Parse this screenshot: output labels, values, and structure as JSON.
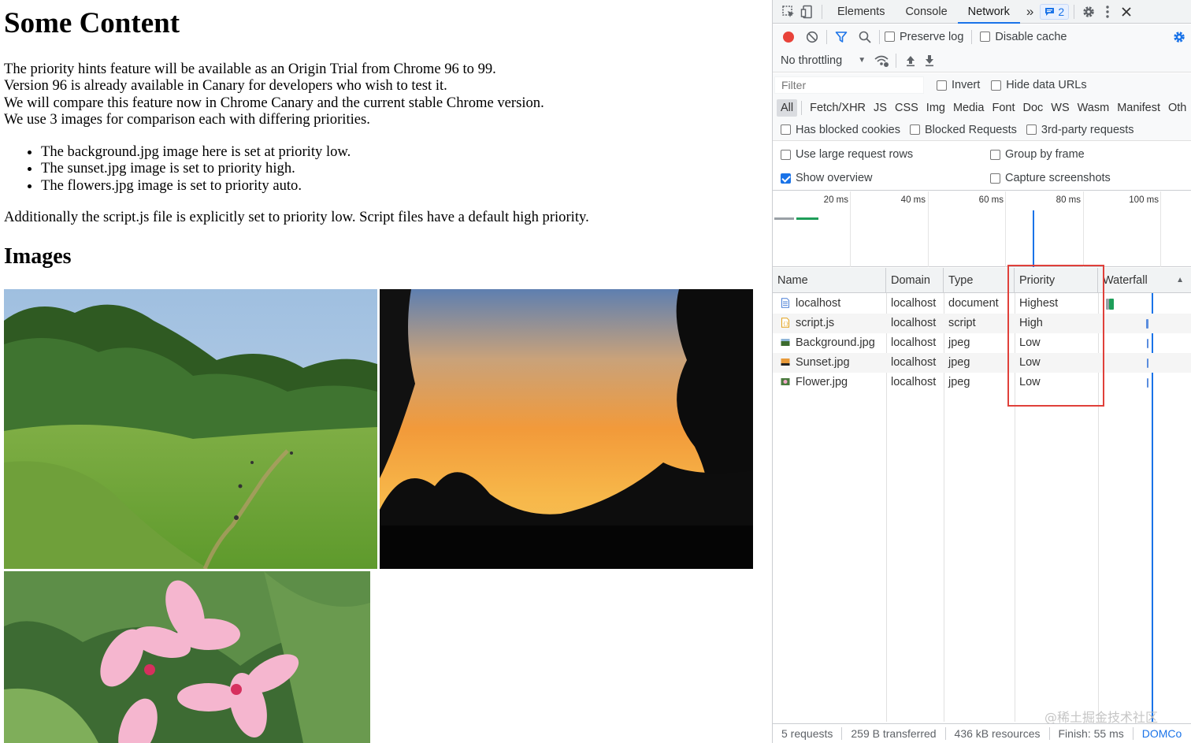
{
  "page": {
    "heading": "Some Content",
    "paragraph_lines": [
      "The priority hints feature will be available as an Origin Trial from Chrome 96 to 99.",
      "Version 96 is already available in Canary for developers who wish to test it.",
      "We will compare this feature now in Chrome Canary and the current stable Chrome version.",
      "We use 3 images for comparison each with differing priorities."
    ],
    "bullets": [
      "The background.jpg image here is set at priority low.",
      "The sunset.jpg image is set to priority high.",
      "The flowers.jpg image is set to priority auto."
    ],
    "paragraph2": "Additionally the script.js file is explicitly set to priority low. Script files have a default high priority.",
    "images_heading": "Images"
  },
  "devtools": {
    "tabs": [
      "Elements",
      "Console",
      "Network"
    ],
    "active_tab": "Network",
    "more_tabs": "»",
    "issues_count": "2",
    "toolbar": {
      "preserve_log": "Preserve log",
      "disable_cache": "Disable cache",
      "throttling": "No throttling",
      "throttling_caret": "▼"
    },
    "filter": {
      "placeholder": "Filter",
      "invert": "Invert",
      "hide_data_urls": "Hide data URLs"
    },
    "types": [
      "All",
      "Fetch/XHR",
      "JS",
      "CSS",
      "Img",
      "Media",
      "Font",
      "Doc",
      "WS",
      "Wasm",
      "Manifest",
      "Oth"
    ],
    "options": {
      "blocked_cookies": "Has blocked cookies",
      "blocked_requests": "Blocked Requests",
      "third_party": "3rd-party requests"
    },
    "settings": {
      "large_rows": "Use large request rows",
      "group_by_frame": "Group by frame",
      "show_overview": "Show overview",
      "capture_screenshots": "Capture screenshots"
    },
    "overview_ticks": [
      "20 ms",
      "40 ms",
      "60 ms",
      "80 ms",
      "100 ms"
    ],
    "columns": {
      "name": "Name",
      "domain": "Domain",
      "type": "Type",
      "priority": "Priority",
      "waterfall": "Waterfall",
      "sort_arrow": "▲"
    },
    "requests": [
      {
        "name": "localhost",
        "domain": "localhost",
        "type": "document",
        "priority": "Highest",
        "icon": "document-icon"
      },
      {
        "name": "script.js",
        "domain": "localhost",
        "type": "script",
        "priority": "High",
        "icon": "script-icon"
      },
      {
        "name": "Background.jpg",
        "domain": "localhost",
        "type": "jpeg",
        "priority": "Low",
        "icon": "image-icon"
      },
      {
        "name": "Sunset.jpg",
        "domain": "localhost",
        "type": "jpeg",
        "priority": "Low",
        "icon": "image-icon"
      },
      {
        "name": "Flower.jpg",
        "domain": "localhost",
        "type": "jpeg",
        "priority": "Low",
        "icon": "image-icon"
      }
    ],
    "status": {
      "requests": "5 requests",
      "transferred": "259 B transferred",
      "resources": "436 kB resources",
      "finish": "Finish: 55 ms",
      "domcontent": "DOMCo"
    },
    "watermark": "@稀土掘金技术社区"
  },
  "colors": {
    "record": "#e8433a",
    "accent": "#1a73e8",
    "highlight": "#e0403a"
  }
}
